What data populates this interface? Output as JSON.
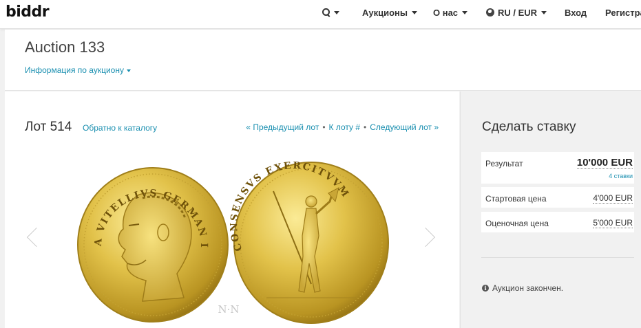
{
  "navbar": {
    "logo": "biddr",
    "auctions": "Аукционы",
    "about": "О нас",
    "locale": "RU / EUR",
    "login": "Вход",
    "register": "Регистра"
  },
  "header": {
    "title": "Auction 133",
    "info_link": "Информация по аукциону"
  },
  "lot": {
    "title": "Лот 514",
    "back_link": "Обратно к каталогу",
    "prev": "« Предыдущий лот",
    "goto": "К лоту #",
    "next": "Следующий лот »",
    "obverse_legend": "A VITELLIVS GERMAN IMP",
    "reverse_legend": "CONSENSVS EXERCITVVM",
    "watermark": "N·N"
  },
  "bid": {
    "title": "Сделать ставку",
    "result_label": "Результат",
    "result_value": "10'000 EUR",
    "bids_count": "4 ставки",
    "start_label": "Стартовая цена",
    "start_value": "4'000 EUR",
    "estimate_label": "Оценочная цена",
    "estimate_value": "5'000 EUR",
    "closed_note": "Аукцион закончен."
  },
  "colors": {
    "link": "#1a8fb0",
    "gold": "#d9b83c"
  }
}
